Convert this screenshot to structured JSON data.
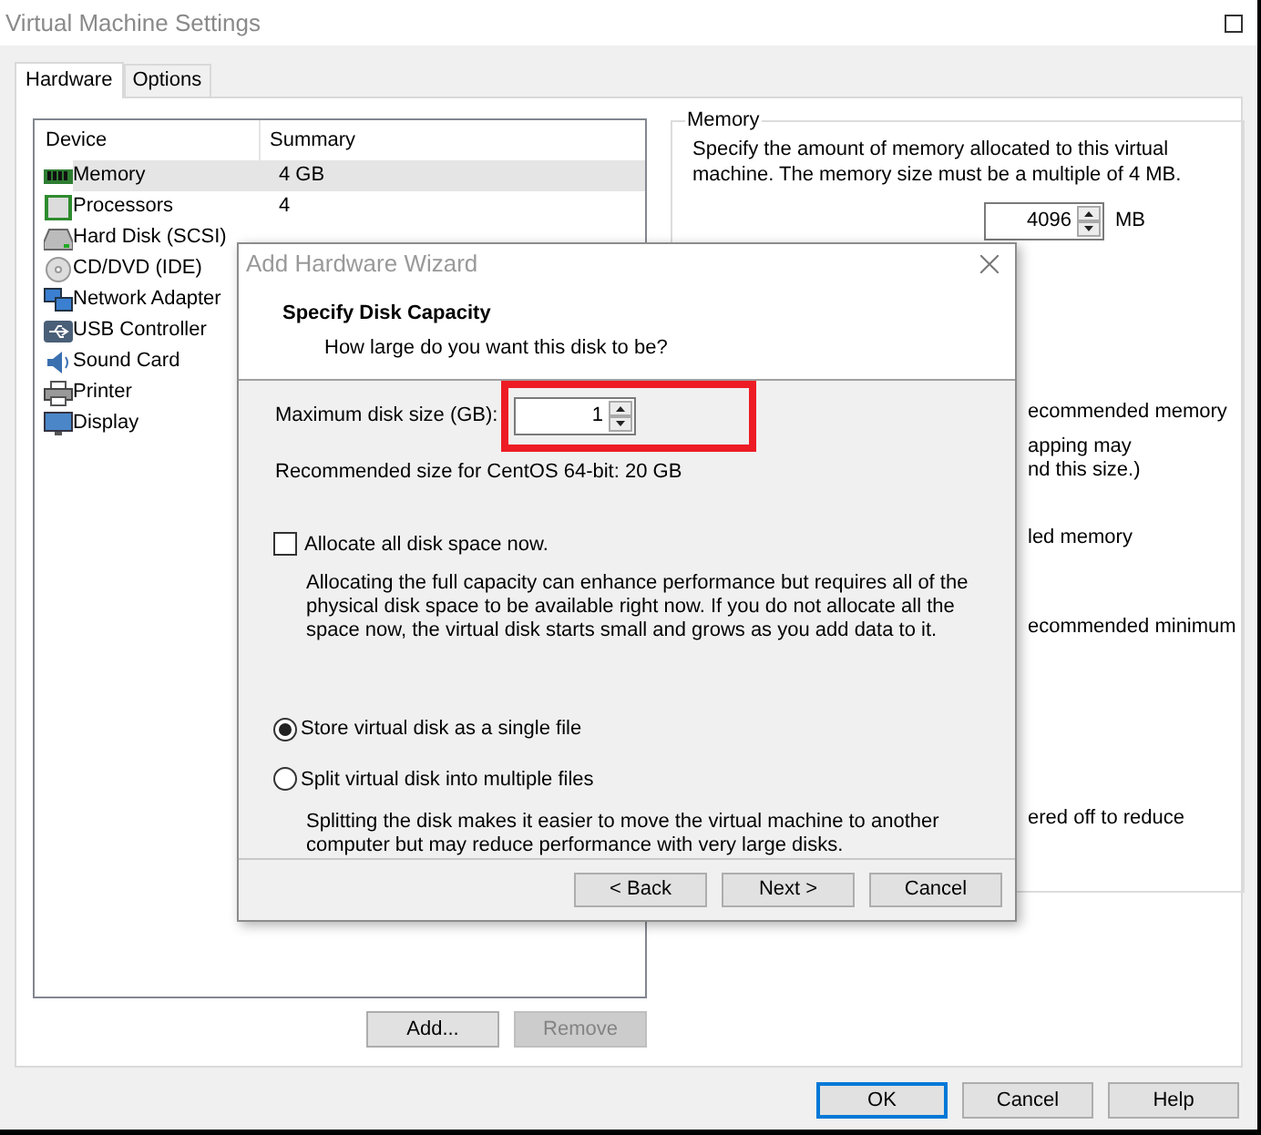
{
  "window": {
    "title": "Virtual Machine Settings"
  },
  "tabs": [
    {
      "label": "Hardware",
      "selected": true
    },
    {
      "label": "Options",
      "selected": false
    }
  ],
  "devices": {
    "columns": [
      "Device",
      "Summary"
    ],
    "rows": [
      {
        "kind": "memory",
        "name": "Memory",
        "summary": "4 GB",
        "selected": true
      },
      {
        "kind": "cpu",
        "name": "Processors",
        "summary": "4",
        "selected": false
      },
      {
        "kind": "disk",
        "name": "Hard Disk (SCSI)",
        "selected": false
      },
      {
        "kind": "cd",
        "name": "CD/DVD (IDE)",
        "selected": false
      },
      {
        "kind": "network",
        "name": "Network Adapter",
        "selected": false
      },
      {
        "kind": "usb",
        "name": "USB Controller",
        "selected": false
      },
      {
        "kind": "sound",
        "name": "Sound Card",
        "selected": false
      },
      {
        "kind": "printer",
        "name": "Printer",
        "selected": false
      },
      {
        "kind": "display",
        "name": "Display",
        "selected": false
      }
    ]
  },
  "list_buttons": [
    {
      "label": "Add...",
      "disabled": false
    },
    {
      "label": "Remove",
      "disabled": true
    }
  ],
  "memory_panel": {
    "title": "Memory",
    "description": "Specify the amount of memory allocated to this virtual machine. The memory size must be a multiple of 4 MB.",
    "memory_value": "4096",
    "unit": "MB",
    "fragments": [
      [
        "ecommended memory"
      ],
      [
        "apping may",
        "nd this size.)"
      ],
      [
        "led memory"
      ],
      [
        "ecommended minimum"
      ],
      [
        "ered off to reduce"
      ]
    ]
  },
  "dialog": {
    "title": "Add Hardware Wizard",
    "heading": "Specify Disk Capacity",
    "subheading": "How large do you want this disk to be?",
    "size_label": "Maximum disk size (GB):",
    "size_value": "1",
    "recommended": "Recommended size for CentOS 64-bit: 20 GB",
    "allocate": {
      "label": "Allocate all disk space now.",
      "checked": false
    },
    "allocate_note": "Allocating the full capacity can enhance performance but requires all of the physical disk space to be available right now. If you do not allocate all the space now, the virtual disk starts small and grows as you add data to it.",
    "storage_options": [
      {
        "label": "Store virtual disk as a single file",
        "selected": true
      },
      {
        "label": "Split virtual disk into multiple files",
        "selected": false
      }
    ],
    "split_note": "Splitting the disk makes it easier to move the virtual machine to another computer but may reduce performance with very large disks.",
    "buttons": [
      "< Back",
      "Next >",
      "Cancel"
    ]
  },
  "footer_buttons": [
    {
      "label": "OK",
      "default": true
    },
    {
      "label": "Cancel",
      "default": false
    },
    {
      "label": "Help",
      "default": false
    }
  ]
}
